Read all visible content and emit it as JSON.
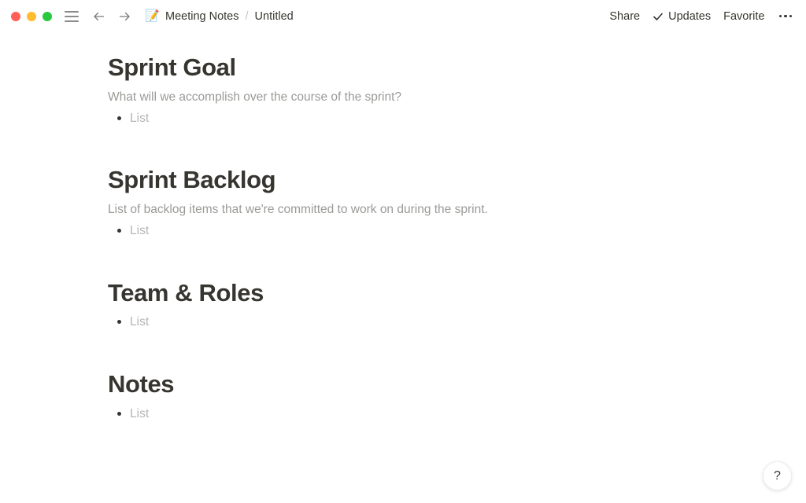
{
  "window": {
    "traffic_lights": [
      {
        "name": "close",
        "color": "#FF5F57"
      },
      {
        "name": "minimize",
        "color": "#FEBC2E"
      },
      {
        "name": "maximize",
        "color": "#28C840"
      }
    ]
  },
  "titlebar": {
    "doc_emoji": "📝",
    "breadcrumb": {
      "parent": "Meeting Notes",
      "separator": "/",
      "current": "Untitled"
    },
    "actions": {
      "share": "Share",
      "updates": "Updates",
      "favorite": "Favorite",
      "more": "•••"
    }
  },
  "main": {
    "sections": [
      {
        "heading": "Sprint Goal",
        "subtitle": "What will we accomplish over the course of the sprint?",
        "list_placeholder": "List"
      },
      {
        "heading": "Sprint Backlog",
        "subtitle": "List of backlog items that we're committed to work on during the sprint.",
        "list_placeholder": "List"
      },
      {
        "heading": "Team & Roles",
        "subtitle": "",
        "list_placeholder": "List"
      },
      {
        "heading": "Notes",
        "subtitle": "",
        "list_placeholder": "List"
      }
    ]
  },
  "help": {
    "label": "?"
  },
  "colors": {
    "text_primary": "#37352F",
    "text_placeholder": "#9B9A97",
    "background": "#FFFFFF"
  }
}
